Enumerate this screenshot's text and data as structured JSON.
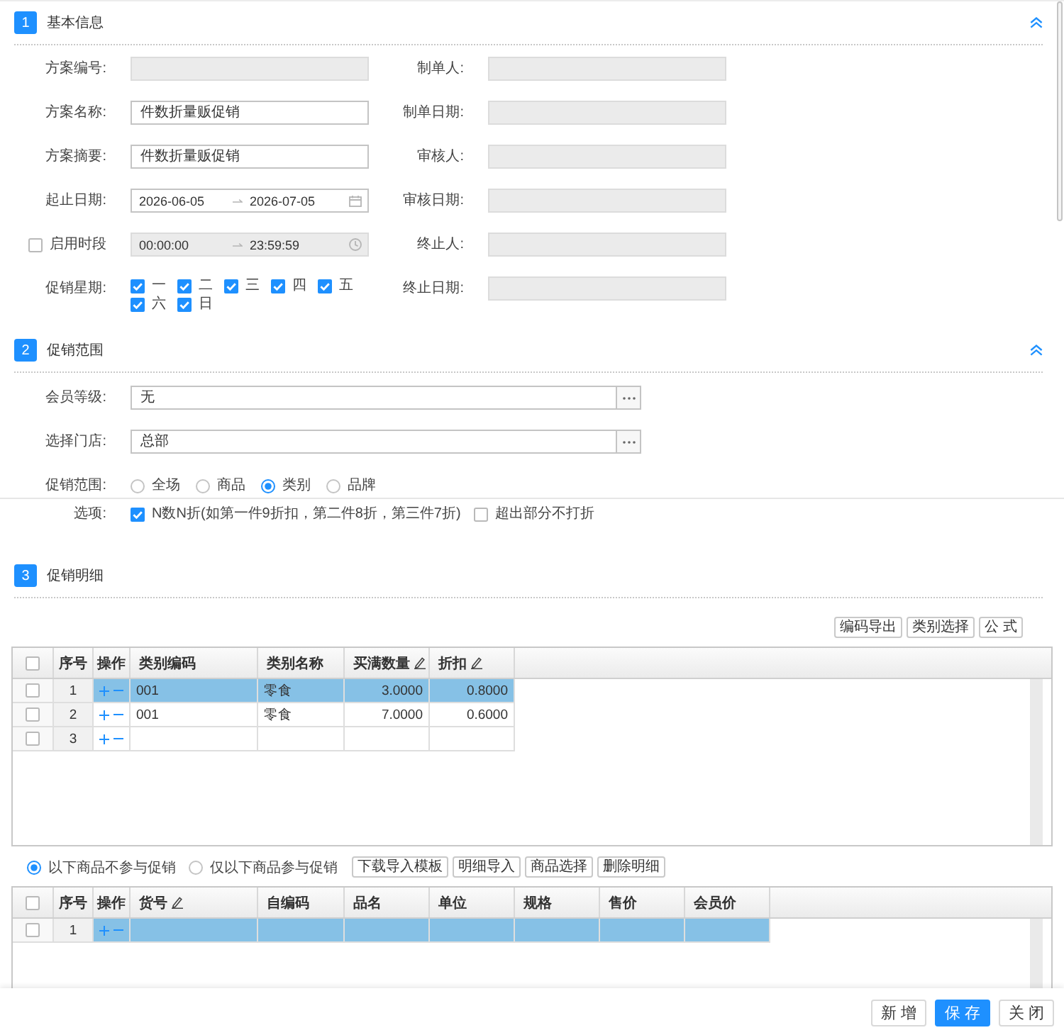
{
  "basic_info": {
    "number": "1",
    "title": "基本信息",
    "expanded": true,
    "fields": [
      {
        "kind": "text",
        "label": "方案编号:",
        "disabled": true
      },
      {
        "kind": "text",
        "label": "制单人:",
        "disabled": true
      },
      {
        "kind": "text",
        "label": "方案名称:",
        "value": "件数折量贩促销",
        "disabled": false
      },
      {
        "kind": "text",
        "label": "制单日期:",
        "disabled": true
      },
      {
        "kind": "text",
        "label": "方案摘要:",
        "value": "件数折量贩促销",
        "disabled": false
      },
      {
        "kind": "text",
        "label": "审核人:",
        "disabled": true
      },
      {
        "kind": "date_range",
        "label": "起止日期:",
        "start": "2026-06-05",
        "end": "2026-07-05",
        "disabled": false
      },
      {
        "kind": "text",
        "label": "审核日期:",
        "disabled": true
      },
      {
        "kind": "time_range",
        "label": "启用时段",
        "checked": false,
        "start": "00:00:00",
        "end": "23:59:59",
        "disabled": true
      },
      {
        "kind": "text",
        "label": "终止人:",
        "disabled": true
      },
      {
        "kind": "weekdays",
        "label": "促销星期:",
        "days": [
          {
            "label": "一",
            "checked": true
          },
          {
            "label": "二",
            "checked": true
          },
          {
            "label": "三",
            "checked": true
          },
          {
            "label": "四",
            "checked": true
          },
          {
            "label": "五",
            "checked": true
          },
          {
            "label": "六",
            "checked": true
          },
          {
            "label": "日",
            "checked": true
          }
        ]
      },
      {
        "kind": "text",
        "label": "终止日期:",
        "disabled": true
      }
    ]
  },
  "promotion_scope": {
    "number": "2",
    "title": "促销范围",
    "expanded": true,
    "pickers": [
      {
        "label": "会员等级:",
        "value": "无"
      },
      {
        "label": "选择门店:",
        "value": "总部"
      }
    ],
    "scope": {
      "label": "促销范围:",
      "options": [
        {
          "label": "全场",
          "selected": false
        },
        {
          "label": "商品",
          "selected": false
        },
        {
          "label": "类别",
          "selected": true
        },
        {
          "label": "品牌",
          "selected": false
        }
      ]
    },
    "options": {
      "label": "选项:",
      "items": [
        {
          "label": "N数N折(如第一件9折扣，第二件8折，第三件7折)",
          "checked": true
        },
        {
          "label": "超出部分不打折",
          "checked": false
        }
      ]
    }
  },
  "promotion_details": {
    "number": "3",
    "title": "促销明细",
    "toolbar": [
      "编码导出",
      "类别选择",
      "公 式"
    ],
    "table": {
      "select_all": false,
      "columns": [
        {
          "label": "序号",
          "kind": "index",
          "editable": false
        },
        {
          "label": "操作",
          "kind": "actions",
          "editable": false
        },
        {
          "label": "类别编码",
          "kind": "text",
          "editable": false
        },
        {
          "label": "类别名称",
          "kind": "text",
          "editable": false
        },
        {
          "label": "买满数量",
          "kind": "number",
          "editable": true
        },
        {
          "label": "折扣",
          "kind": "number",
          "editable": true
        }
      ],
      "rows": [
        {
          "index": "1",
          "selected": true,
          "checked": false,
          "cells": [
            "001",
            "零食",
            "3.0000",
            "0.8000"
          ]
        },
        {
          "index": "2",
          "selected": false,
          "checked": false,
          "cells": [
            "001",
            "零食",
            "7.0000",
            "0.6000"
          ]
        },
        {
          "index": "3",
          "selected": false,
          "checked": false
        }
      ]
    },
    "item_mode": [
      {
        "label": "以下商品不参与促销",
        "selected": true
      },
      {
        "label": "仅以下商品参与促销",
        "selected": false
      }
    ],
    "item_buttons": [
      "下载导入模板",
      "明细导入",
      "商品选择",
      "删除明细"
    ],
    "items_table": {
      "select_all": false,
      "columns": [
        {
          "label": "序号",
          "kind": "index",
          "editable": false
        },
        {
          "label": "操作",
          "kind": "actions",
          "editable": false
        },
        {
          "label": "货号",
          "kind": "text",
          "editable": true
        },
        {
          "label": "自编码",
          "kind": "text",
          "editable": false
        },
        {
          "label": "品名",
          "kind": "text",
          "editable": false
        },
        {
          "label": "单位",
          "kind": "text",
          "editable": false
        },
        {
          "label": "规格",
          "kind": "text",
          "editable": false
        },
        {
          "label": "售价",
          "kind": "number",
          "editable": false
        },
        {
          "label": "会员价",
          "kind": "number",
          "editable": false
        }
      ],
      "rows": [
        {
          "index": "1",
          "selected": true,
          "checked": false
        }
      ]
    }
  },
  "footer_buttons": [
    {
      "label": "新 增",
      "kind": "default"
    },
    {
      "label": "保 存",
      "kind": "primary"
    },
    {
      "label": "关 闭",
      "kind": "default"
    }
  ]
}
